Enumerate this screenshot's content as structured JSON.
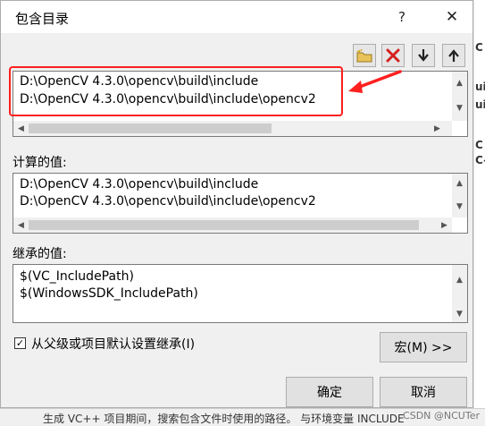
{
  "dialog": {
    "title": "包含目录",
    "help_label": "?",
    "close_label": "✕"
  },
  "toolbar": {
    "new_folder_icon": "folder-new-icon",
    "delete_icon": "delete-icon",
    "move_down_icon": "arrow-down-icon",
    "move_up_icon": "arrow-up-icon"
  },
  "include_list": {
    "rows": [
      "D:\\OpenCV 4.3.0\\opencv\\build\\include",
      "D:\\OpenCV 4.3.0\\opencv\\build\\include\\opencv2"
    ]
  },
  "computed": {
    "label": "计算的值:",
    "rows": [
      "D:\\OpenCV 4.3.0\\opencv\\build\\include",
      "D:\\OpenCV 4.3.0\\opencv\\build\\include\\opencv2"
    ]
  },
  "inherited": {
    "label": "继承的值:",
    "rows": [
      "$(VC_IncludePath)",
      "$(WindowsSDK_IncludePath)"
    ]
  },
  "inherit_checkbox": {
    "label": "从父级或项目默认设置继承(I)",
    "checked": true
  },
  "buttons": {
    "macro": "宏(M) >>",
    "ok": "确定",
    "cancel": "取消"
  },
  "background": {
    "bottom_text": "生成 VC++ 项目期间，搜索包含文件时使用的路径。 与环境变量 INCLUDE",
    "side_fragments": [
      "C",
      "ui",
      "ui",
      "C",
      "C-"
    ],
    "watermark": "CSDN @NCUTer"
  },
  "colors": {
    "annotation": "#ff2020"
  }
}
